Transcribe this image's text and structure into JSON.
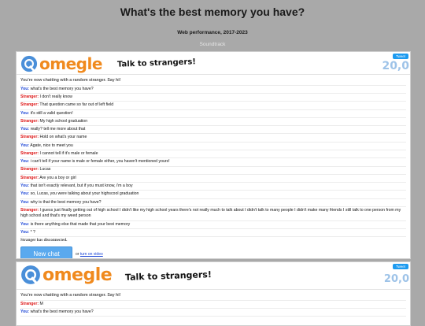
{
  "page": {
    "title": "What's the best memory you have?",
    "subtitle": "Web performance, 2017-2023",
    "link": "Soundtrack"
  },
  "colors": {
    "background": "#a9a9a9",
    "brand_orange": "#f08a1e",
    "you": "#1a44d6",
    "stranger": "#dd1111",
    "button": "#5aa9ee"
  },
  "shot1": {
    "logo": "omegle",
    "tagline": "Talk to strangers!",
    "tweet": "Tweet",
    "online": "20,0",
    "system_start": "You're now chatting with a random stranger. Say hi!",
    "messages": [
      {
        "who": "You:",
        "role": "you",
        "text": "what's the best memory you have?"
      },
      {
        "who": "Stranger:",
        "role": "stranger",
        "text": "I don't really know"
      },
      {
        "who": "Stranger:",
        "role": "stranger",
        "text": "That question came so far out of left field"
      },
      {
        "who": "You:",
        "role": "you",
        "text": "it's still a valid question!"
      },
      {
        "who": "Stranger:",
        "role": "stranger",
        "text": "My high school graduation"
      },
      {
        "who": "You:",
        "role": "you",
        "text": "really? tell me more about that"
      },
      {
        "who": "Stranger:",
        "role": "stranger",
        "text": "Hold on what's your name"
      },
      {
        "who": "You:",
        "role": "you",
        "text": "Agate, nice to meet you"
      },
      {
        "who": "Stranger:",
        "role": "stranger",
        "text": "I cannot tell if it's male or female"
      },
      {
        "who": "You:",
        "role": "you",
        "text": "i can't tell if your name is male or female either, you haven't mentioned yours!"
      },
      {
        "who": "Stranger:",
        "role": "stranger",
        "text": "Lucas"
      },
      {
        "who": "Stranger:",
        "role": "stranger",
        "text": "Are you a boy or girl"
      },
      {
        "who": "You:",
        "role": "you",
        "text": "that isn't exactly relevant, but if you must know, i'm a boy"
      },
      {
        "who": "You:",
        "role": "you",
        "text": "so, Lucas, you were talking about your highscool graduation"
      },
      {
        "who": "You:",
        "role": "you",
        "text": "why is that the best memory you have?"
      },
      {
        "who": "Stranger:",
        "role": "stranger",
        "text": "I guess just finally getting out of high school I didn't like my high school years there's not really much to talk about I didn't talk to many people I didn't make many friends I still talk to one person from my high school and that's my weed person"
      },
      {
        "who": "You:",
        "role": "you",
        "text": "is there anything else that made that your best memory"
      },
      {
        "who": "You:",
        "role": "you",
        "text": "* ?"
      }
    ],
    "system_end": "Stranger has disconnected.",
    "new_chat": "New chat",
    "or_text": "or",
    "video_link": "turn on video"
  },
  "shot2": {
    "logo": "omegle",
    "tagline": "Talk to strangers!",
    "tweet": "Tweet",
    "online": "20,0",
    "system_start": "You're now chatting with a random stranger. Say hi!",
    "messages": [
      {
        "who": "Stranger:",
        "role": "stranger",
        "text": "M"
      },
      {
        "who": "You:",
        "role": "you",
        "text": "what's the best memory you have?"
      }
    ]
  }
}
